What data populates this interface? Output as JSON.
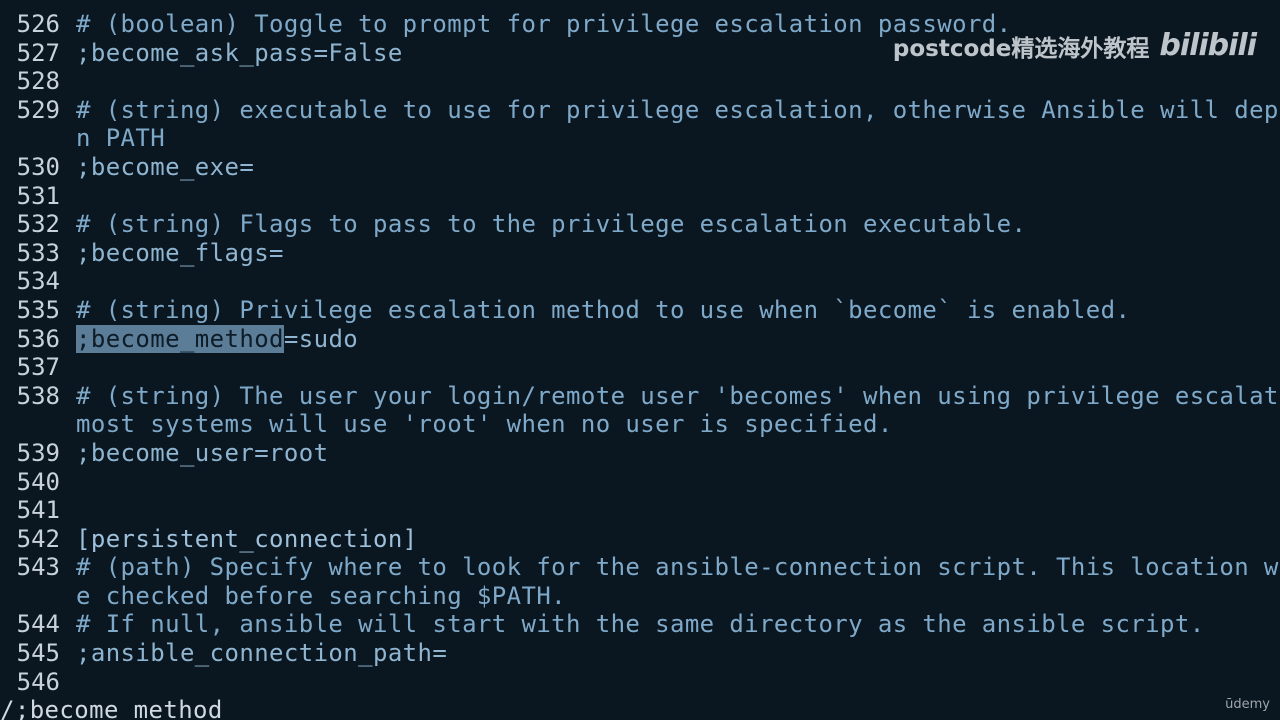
{
  "editor": {
    "lines": [
      {
        "num": "526",
        "text": "# (boolean) Toggle to prompt for privilege escalation password.",
        "kind": "comment"
      },
      {
        "num": "527",
        "text": ";become_ask_pass=False",
        "kind": "setting"
      },
      {
        "num": "528",
        "text": "",
        "kind": "blank"
      },
      {
        "num": "529",
        "text": "# (string) executable to use for privilege escalation, otherwise Ansible will dep",
        "kind": "comment"
      },
      {
        "num": "",
        "text": "n PATH",
        "kind": "comment"
      },
      {
        "num": "530",
        "text": ";become_exe=",
        "kind": "setting"
      },
      {
        "num": "531",
        "text": "",
        "kind": "blank"
      },
      {
        "num": "532",
        "text": "# (string) Flags to pass to the privilege escalation executable.",
        "kind": "comment"
      },
      {
        "num": "533",
        "text": ";become_flags=",
        "kind": "setting"
      },
      {
        "num": "534",
        "text": "",
        "kind": "blank"
      },
      {
        "num": "535",
        "text": "# (string) Privilege escalation method to use when `become` is enabled.",
        "kind": "comment"
      },
      {
        "num": "536",
        "text": ";become_method=sudo",
        "kind": "setting",
        "highlight": ";become_method",
        "rest": "=sudo"
      },
      {
        "num": "537",
        "text": "",
        "kind": "blank"
      },
      {
        "num": "538",
        "text": "# (string) The user your login/remote user 'becomes' when using privilege escalat",
        "kind": "comment"
      },
      {
        "num": "",
        "text": "most systems will use 'root' when no user is specified.",
        "kind": "comment"
      },
      {
        "num": "539",
        "text": ";become_user=root",
        "kind": "setting"
      },
      {
        "num": "540",
        "text": "",
        "kind": "blank"
      },
      {
        "num": "541",
        "text": "",
        "kind": "blank"
      },
      {
        "num": "542",
        "text": "[persistent_connection]",
        "kind": "section"
      },
      {
        "num": "543",
        "text": "# (path) Specify where to look for the ansible-connection script. This location w",
        "kind": "comment"
      },
      {
        "num": "",
        "text": "e checked before searching $PATH.",
        "kind": "comment"
      },
      {
        "num": "544",
        "text": "# If null, ansible will start with the same directory as the ansible script.",
        "kind": "comment"
      },
      {
        "num": "545",
        "text": ";ansible_connection_path=",
        "kind": "setting"
      },
      {
        "num": "546",
        "text": "",
        "kind": "blank"
      }
    ]
  },
  "command_line": "/;become_method",
  "watermark": {
    "text": "postcode精选海外教程",
    "logo": "bilibili"
  },
  "udemy": "ūdemy"
}
